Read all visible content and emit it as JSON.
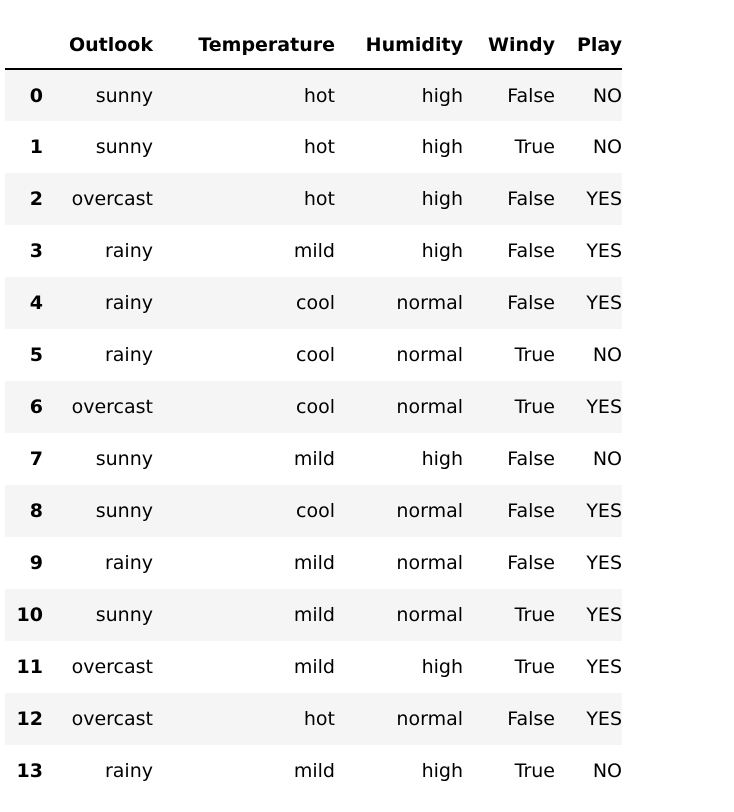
{
  "table": {
    "index_header": "",
    "columns": [
      "Outlook",
      "Temperature",
      "Humidity",
      "Windy",
      "Play"
    ],
    "row_count": 14,
    "colors": {
      "stripe": "#f5f5f5",
      "background": "#ffffff",
      "text": "#000000",
      "header_rule": "#000000"
    },
    "rows": [
      {
        "index": "0",
        "Outlook": "sunny",
        "Temperature": "hot",
        "Humidity": "high",
        "Windy": "False",
        "Play": "NO"
      },
      {
        "index": "1",
        "Outlook": "sunny",
        "Temperature": "hot",
        "Humidity": "high",
        "Windy": "True",
        "Play": "NO"
      },
      {
        "index": "2",
        "Outlook": "overcast",
        "Temperature": "hot",
        "Humidity": "high",
        "Windy": "False",
        "Play": "YES"
      },
      {
        "index": "3",
        "Outlook": "rainy",
        "Temperature": "mild",
        "Humidity": "high",
        "Windy": "False",
        "Play": "YES"
      },
      {
        "index": "4",
        "Outlook": "rainy",
        "Temperature": "cool",
        "Humidity": "normal",
        "Windy": "False",
        "Play": "YES"
      },
      {
        "index": "5",
        "Outlook": "rainy",
        "Temperature": "cool",
        "Humidity": "normal",
        "Windy": "True",
        "Play": "NO"
      },
      {
        "index": "6",
        "Outlook": "overcast",
        "Temperature": "cool",
        "Humidity": "normal",
        "Windy": "True",
        "Play": "YES"
      },
      {
        "index": "7",
        "Outlook": "sunny",
        "Temperature": "mild",
        "Humidity": "high",
        "Windy": "False",
        "Play": "NO"
      },
      {
        "index": "8",
        "Outlook": "sunny",
        "Temperature": "cool",
        "Humidity": "normal",
        "Windy": "False",
        "Play": "YES"
      },
      {
        "index": "9",
        "Outlook": "rainy",
        "Temperature": "mild",
        "Humidity": "normal",
        "Windy": "False",
        "Play": "YES"
      },
      {
        "index": "10",
        "Outlook": "sunny",
        "Temperature": "mild",
        "Humidity": "normal",
        "Windy": "True",
        "Play": "YES"
      },
      {
        "index": "11",
        "Outlook": "overcast",
        "Temperature": "mild",
        "Humidity": "high",
        "Windy": "True",
        "Play": "YES"
      },
      {
        "index": "12",
        "Outlook": "overcast",
        "Temperature": "hot",
        "Humidity": "normal",
        "Windy": "False",
        "Play": "YES"
      },
      {
        "index": "13",
        "Outlook": "rainy",
        "Temperature": "mild",
        "Humidity": "high",
        "Windy": "True",
        "Play": "NO"
      }
    ]
  }
}
